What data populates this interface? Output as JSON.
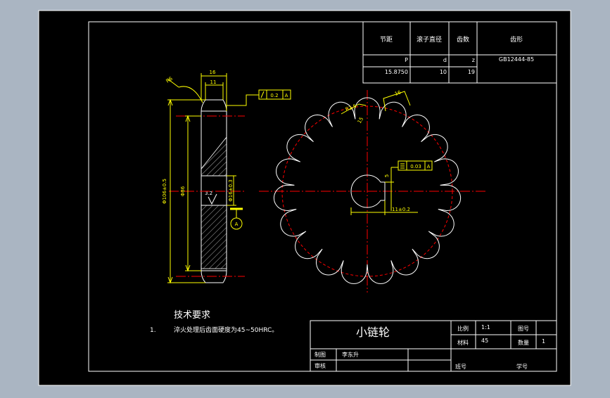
{
  "colors": {
    "background": "#000000",
    "outer": "#aab5c2",
    "outline": "#ffffff",
    "dimension": "#ffff00",
    "centerline": "#ff0000"
  },
  "param_table": {
    "headers": [
      "节距",
      "滚子直径",
      "齿数",
      "齿形"
    ],
    "symbols": [
      "P",
      "d",
      "z"
    ],
    "values": [
      "15.8750",
      "10",
      "19"
    ],
    "standard": "GB12444-85"
  },
  "dims": {
    "top_width": "16",
    "inner_width": "11",
    "chamfer": "R6",
    "outer_dia": "Φ106±0.5",
    "hub_dia": "Φ86",
    "bore_dia": "Φ16±0.3",
    "roughness": "3.2",
    "runout": "0.2",
    "flatness": "0.03",
    "datum": "A",
    "tooth_r": "R2.5",
    "pitch_mark": "16",
    "angle": "15",
    "key_width": "5",
    "key_depth": "11±0.2"
  },
  "tech": {
    "heading": "技术要求",
    "item_no": "1.",
    "item_text": "淬火处理后齿面硬度为45~50HRC。"
  },
  "title_block": {
    "part_name": "小链轮",
    "scale_label": "比例",
    "scale_value": "1:1",
    "drawing_no_label": "图号",
    "material_label": "材料",
    "material_value": "45",
    "qty_label": "数量",
    "qty_value": "1",
    "drawn_label": "制图",
    "drawn_by": "李东升",
    "checked_label": "审核",
    "class_label": "班号",
    "student_label": "学号"
  }
}
